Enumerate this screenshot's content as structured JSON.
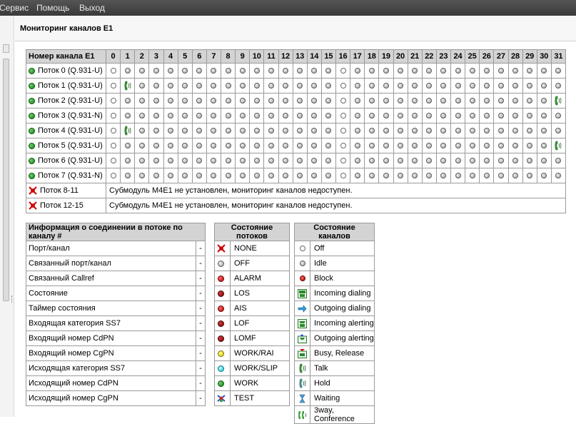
{
  "menu": {
    "items": [
      "Сервис",
      "Помощь",
      "Выход"
    ]
  },
  "page": {
    "title": "Мониторинг каналов E1"
  },
  "grid": {
    "header": "Номер канала E1",
    "channels": [
      "0",
      "1",
      "2",
      "3",
      "4",
      "5",
      "6",
      "7",
      "8",
      "9",
      "10",
      "11",
      "12",
      "13",
      "14",
      "15",
      "16",
      "17",
      "18",
      "19",
      "20",
      "21",
      "22",
      "23",
      "24",
      "25",
      "26",
      "27",
      "28",
      "29",
      "30",
      "31"
    ],
    "streams": [
      {
        "name": "Поток 0 (Q.931-U)",
        "status": "work",
        "cells": [
          "white",
          "gray",
          "gray",
          "gray",
          "gray",
          "gray",
          "gray",
          "gray",
          "gray",
          "gray",
          "gray",
          "gray",
          "gray",
          "gray",
          "gray",
          "gray",
          "white",
          "gray",
          "gray",
          "gray",
          "gray",
          "gray",
          "gray",
          "gray",
          "gray",
          "gray",
          "gray",
          "gray",
          "gray",
          "gray",
          "gray",
          "gray"
        ]
      },
      {
        "name": "Поток 1 (Q.931-U)",
        "status": "work",
        "cells": [
          "white",
          "talk",
          "gray",
          "gray",
          "gray",
          "gray",
          "gray",
          "gray",
          "gray",
          "gray",
          "gray",
          "gray",
          "gray",
          "gray",
          "gray",
          "gray",
          "white",
          "gray",
          "gray",
          "gray",
          "gray",
          "gray",
          "gray",
          "gray",
          "gray",
          "gray",
          "gray",
          "gray",
          "gray",
          "gray",
          "gray",
          "gray"
        ]
      },
      {
        "name": "Поток 2 (Q.931-U)",
        "status": "work",
        "cells": [
          "white",
          "gray",
          "gray",
          "gray",
          "gray",
          "gray",
          "gray",
          "gray",
          "gray",
          "gray",
          "gray",
          "gray",
          "gray",
          "gray",
          "gray",
          "gray",
          "white",
          "gray",
          "gray",
          "gray",
          "gray",
          "gray",
          "gray",
          "gray",
          "gray",
          "gray",
          "gray",
          "gray",
          "gray",
          "gray",
          "gray",
          "talk"
        ]
      },
      {
        "name": "Поток 3 (Q.931-N)",
        "status": "work",
        "cells": [
          "white",
          "gray",
          "gray",
          "gray",
          "gray",
          "gray",
          "gray",
          "gray",
          "gray",
          "gray",
          "gray",
          "gray",
          "gray",
          "gray",
          "gray",
          "gray",
          "white",
          "gray",
          "gray",
          "gray",
          "gray",
          "gray",
          "gray",
          "gray",
          "gray",
          "gray",
          "gray",
          "gray",
          "gray",
          "gray",
          "gray",
          "gray"
        ]
      },
      {
        "name": "Поток 4 (Q.931-U)",
        "status": "work",
        "cells": [
          "white",
          "talk",
          "gray",
          "gray",
          "gray",
          "gray",
          "gray",
          "gray",
          "gray",
          "gray",
          "gray",
          "gray",
          "gray",
          "gray",
          "gray",
          "gray",
          "white",
          "gray",
          "gray",
          "gray",
          "gray",
          "gray",
          "gray",
          "gray",
          "gray",
          "gray",
          "gray",
          "gray",
          "gray",
          "gray",
          "gray",
          "gray"
        ]
      },
      {
        "name": "Поток 5 (Q.931-U)",
        "status": "work",
        "cells": [
          "white",
          "gray",
          "gray",
          "gray",
          "gray",
          "gray",
          "gray",
          "gray",
          "gray",
          "gray",
          "gray",
          "gray",
          "gray",
          "gray",
          "gray",
          "gray",
          "white",
          "gray",
          "gray",
          "gray",
          "gray",
          "gray",
          "gray",
          "gray",
          "gray",
          "gray",
          "gray",
          "gray",
          "gray",
          "gray",
          "gray",
          "talk"
        ]
      },
      {
        "name": "Поток 6 (Q.931-U)",
        "status": "work",
        "cells": [
          "white",
          "gray",
          "gray",
          "gray",
          "gray",
          "gray",
          "gray",
          "gray",
          "gray",
          "gray",
          "gray",
          "gray",
          "gray",
          "gray",
          "gray",
          "gray",
          "white",
          "gray",
          "gray",
          "gray",
          "gray",
          "gray",
          "gray",
          "gray",
          "gray",
          "gray",
          "gray",
          "gray",
          "gray",
          "gray",
          "gray",
          "gray"
        ]
      },
      {
        "name": "Поток 7 (Q.931-N)",
        "status": "work",
        "cells": [
          "white",
          "gray",
          "gray",
          "gray",
          "gray",
          "gray",
          "gray",
          "gray",
          "gray",
          "gray",
          "gray",
          "gray",
          "gray",
          "gray",
          "gray",
          "gray",
          "white",
          "gray",
          "gray",
          "gray",
          "gray",
          "gray",
          "gray",
          "gray",
          "gray",
          "gray",
          "gray",
          "gray",
          "gray",
          "gray",
          "gray",
          "gray"
        ]
      }
    ],
    "missing": [
      {
        "name": "Поток 8-11",
        "message": "Субмодуль M4E1 не установлен, мониторинг каналов недоступен."
      },
      {
        "name": "Поток 12-15",
        "message": "Субмодуль M4E1 не установлен, мониторинг каналов недоступен."
      }
    ]
  },
  "info": {
    "header": "Информация о соединении в потоке по каналу #",
    "rows": [
      {
        "label": "Порт/канал",
        "value": "-"
      },
      {
        "label": "Связанный порт/канал",
        "value": "-"
      },
      {
        "label": "Связанный Callref",
        "value": "-"
      },
      {
        "label": "Состояние",
        "value": "-"
      },
      {
        "label": "Таймер состояния",
        "value": "-"
      },
      {
        "label": "Входящая категория SS7",
        "value": "-"
      },
      {
        "label": "Входящий номер CdPN",
        "value": "-"
      },
      {
        "label": "Входящий номер CgPN",
        "value": "-"
      },
      {
        "label": "Исходящая категория SS7",
        "value": "-"
      },
      {
        "label": "Исходящий номер CdPN",
        "value": "-"
      },
      {
        "label": "Исходящий номер CgPN",
        "value": "-"
      }
    ]
  },
  "stream_states": {
    "header": "Состояние потоков",
    "items": [
      {
        "label": "NONE",
        "icon": "none"
      },
      {
        "label": "OFF",
        "icon": "gray"
      },
      {
        "label": "ALARM",
        "icon": "red"
      },
      {
        "label": "LOS",
        "icon": "dred"
      },
      {
        "label": "AIS",
        "icon": "red"
      },
      {
        "label": "LOF",
        "icon": "dred"
      },
      {
        "label": "LOMF",
        "icon": "dred"
      },
      {
        "label": "WORK/RAI",
        "icon": "yellow"
      },
      {
        "label": "WORK/SLIP",
        "icon": "cyan"
      },
      {
        "label": "WORK",
        "icon": "green"
      },
      {
        "label": "TEST",
        "icon": "test"
      }
    ]
  },
  "channel_states": {
    "header": "Состояние каналов",
    "items": [
      {
        "label": "Off",
        "icon": "white"
      },
      {
        "label": "Idle",
        "icon": "gray"
      },
      {
        "label": "Block",
        "icon": "red"
      },
      {
        "label": "Incoming dialing",
        "icon": "incoming-dialing"
      },
      {
        "label": "Outgoing dialing",
        "icon": "outgoing-dialing"
      },
      {
        "label": "Incoming alerting",
        "icon": "incoming-alerting"
      },
      {
        "label": "Outgoing alerting",
        "icon": "outgoing-alerting"
      },
      {
        "label": "Busy, Release",
        "icon": "busy"
      },
      {
        "label": "Talk",
        "icon": "talk"
      },
      {
        "label": "Hold",
        "icon": "hold"
      },
      {
        "label": "Waiting",
        "icon": "waiting"
      },
      {
        "label": "3way, Conference",
        "icon": "conference"
      }
    ]
  }
}
